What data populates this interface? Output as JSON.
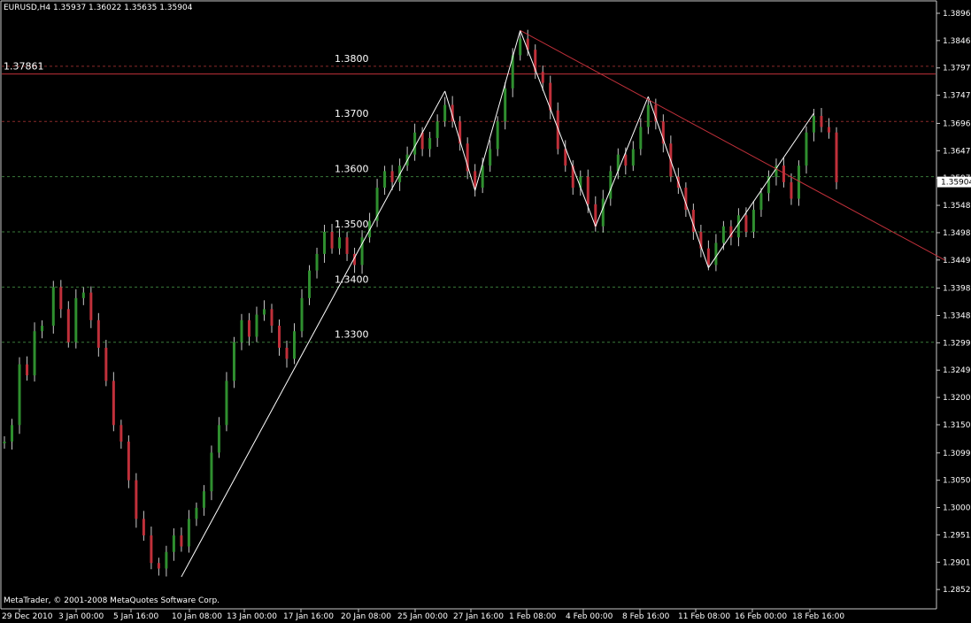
{
  "window": {
    "symbol_header": "EURUSD,H4  1.35937 1.36022 1.35635 1.35904",
    "copyright": "MetaTrader, © 2001-2008 MetaQuotes Software Corp."
  },
  "colors": {
    "background": "#000000",
    "frame": "#c8c8c8",
    "axis_text": "#ffffff",
    "bull_candle": "#2f8f2f",
    "bear_candle": "#c0303a",
    "wick": "#c8c8c8",
    "resistance_line": "#c0303a",
    "zigzag": "#ffffff",
    "green_level": "#3a7a3a",
    "red_level": "#8a2a2a",
    "price_box_bg": "#ffffff",
    "price_box_text": "#000000"
  },
  "chart_data": {
    "type": "candlestick",
    "symbol": "EURUSD",
    "timeframe": "H4",
    "current_price": 1.35904,
    "ylim": [
      1.2825,
      1.3896
    ],
    "y_ticks": [
      "1.38960",
      "1.38465",
      "1.37970",
      "1.37475",
      "1.36965",
      "1.36470",
      "1.35975",
      "1.35480",
      "1.34985",
      "1.34490",
      "1.33980",
      "1.33485",
      "1.32990",
      "1.32495",
      "1.32000",
      "1.31505",
      "1.30995",
      "1.30500",
      "1.30005",
      "1.29510",
      "1.29015",
      "1.28520"
    ],
    "x_ticks": [
      "29 Dec 2010",
      "3 Jan 00:00",
      "5 Jan 16:00",
      "10 Jan 08:00",
      "13 Jan 00:00",
      "17 Jan 16:00",
      "20 Jan 08:00",
      "25 Jan 00:00",
      "27 Jan 16:00",
      "1 Feb 08:00",
      "4 Feb 00:00",
      "8 Feb 16:00",
      "11 Feb 08:00",
      "16 Feb 00:00",
      "18 Feb 16:00"
    ],
    "price_path": [
      [
        0,
        1.312
      ],
      [
        2,
        1.315
      ],
      [
        4,
        1.326
      ],
      [
        6,
        1.324
      ],
      [
        8,
        1.332
      ],
      [
        10,
        1.333
      ],
      [
        13,
        1.34
      ],
      [
        15,
        1.336
      ],
      [
        17,
        1.33
      ],
      [
        19,
        1.338
      ],
      [
        21,
        1.339
      ],
      [
        23,
        1.334
      ],
      [
        25,
        1.329
      ],
      [
        27,
        1.323
      ],
      [
        29,
        1.315
      ],
      [
        31,
        1.312
      ],
      [
        33,
        1.305
      ],
      [
        35,
        1.298
      ],
      [
        37,
        1.295
      ],
      [
        39,
        1.29
      ],
      [
        41,
        1.289
      ],
      [
        43,
        1.292
      ],
      [
        45,
        1.295
      ],
      [
        47,
        1.293
      ],
      [
        49,
        1.298
      ],
      [
        51,
        1.3
      ],
      [
        53,
        1.303
      ],
      [
        55,
        1.31
      ],
      [
        57,
        1.315
      ],
      [
        59,
        1.323
      ],
      [
        61,
        1.33
      ],
      [
        63,
        1.334
      ],
      [
        65,
        1.331
      ],
      [
        67,
        1.335
      ],
      [
        69,
        1.336
      ],
      [
        71,
        1.333
      ],
      [
        73,
        1.329
      ],
      [
        75,
        1.327
      ],
      [
        77,
        1.332
      ],
      [
        79,
        1.338
      ],
      [
        81,
        1.343
      ],
      [
        83,
        1.346
      ],
      [
        85,
        1.35
      ],
      [
        87,
        1.347
      ],
      [
        89,
        1.349
      ],
      [
        91,
        1.346
      ],
      [
        93,
        1.344
      ],
      [
        95,
        1.349
      ],
      [
        97,
        1.352
      ],
      [
        99,
        1.358
      ],
      [
        101,
        1.361
      ],
      [
        103,
        1.359
      ],
      [
        105,
        1.362
      ],
      [
        107,
        1.364
      ],
      [
        109,
        1.368
      ],
      [
        111,
        1.365
      ],
      [
        113,
        1.367
      ],
      [
        115,
        1.37
      ],
      [
        117,
        1.373
      ],
      [
        119,
        1.37
      ],
      [
        121,
        1.366
      ],
      [
        123,
        1.361
      ],
      [
        125,
        1.358
      ],
      [
        127,
        1.362
      ],
      [
        129,
        1.365
      ],
      [
        131,
        1.37
      ],
      [
        133,
        1.376
      ],
      [
        135,
        1.382
      ],
      [
        137,
        1.385
      ],
      [
        139,
        1.383
      ],
      [
        141,
        1.379
      ],
      [
        143,
        1.377
      ],
      [
        145,
        1.372
      ],
      [
        147,
        1.365
      ],
      [
        149,
        1.362
      ],
      [
        151,
        1.358
      ],
      [
        153,
        1.36
      ],
      [
        155,
        1.355
      ],
      [
        157,
        1.351
      ],
      [
        159,
        1.356
      ],
      [
        161,
        1.361
      ],
      [
        163,
        1.364
      ],
      [
        165,
        1.362
      ],
      [
        167,
        1.365
      ],
      [
        169,
        1.369
      ],
      [
        171,
        1.373
      ],
      [
        173,
        1.37
      ],
      [
        175,
        1.366
      ],
      [
        177,
        1.36
      ],
      [
        179,
        1.358
      ],
      [
        181,
        1.354
      ],
      [
        183,
        1.35
      ],
      [
        185,
        1.347
      ],
      [
        187,
        1.344
      ],
      [
        189,
        1.348
      ],
      [
        191,
        1.351
      ],
      [
        193,
        1.349
      ],
      [
        195,
        1.353
      ],
      [
        197,
        1.35
      ],
      [
        199,
        1.354
      ],
      [
        201,
        1.357
      ],
      [
        203,
        1.36
      ],
      [
        205,
        1.362
      ],
      [
        207,
        1.359
      ],
      [
        209,
        1.356
      ],
      [
        211,
        1.362
      ],
      [
        213,
        1.368
      ],
      [
        215,
        1.371
      ],
      [
        217,
        1.369
      ],
      [
        219,
        1.368
      ],
      [
        221,
        1.359
      ]
    ],
    "zigzag_points": [
      [
        47,
        1.2875
      ],
      [
        117,
        1.3755
      ],
      [
        125,
        1.3575
      ],
      [
        137,
        1.3865
      ],
      [
        157,
        1.351
      ],
      [
        171,
        1.3745
      ],
      [
        187,
        1.3435
      ],
      [
        215,
        1.3715
      ]
    ],
    "horizontal_levels": [
      {
        "price": 1.38,
        "label": "1.3800",
        "kind": "red_dashed"
      },
      {
        "price": 1.3786,
        "label": "1.37861",
        "kind": "red_solid"
      },
      {
        "price": 1.37,
        "label": "1.3700",
        "kind": "red_dashed"
      },
      {
        "price": 1.36,
        "label": "1.3600",
        "kind": "green_dashed"
      },
      {
        "price": 1.35,
        "label": "1.3500",
        "kind": "green_dashed"
      },
      {
        "price": 1.34,
        "label": "1.3400",
        "kind": "green_dashed"
      },
      {
        "price": 1.33,
        "label": "1.3300",
        "kind": "green_dashed"
      }
    ],
    "trendline": {
      "start": [
        137,
        1.3865
      ],
      "end": [
        250,
        1.3448
      ]
    }
  }
}
